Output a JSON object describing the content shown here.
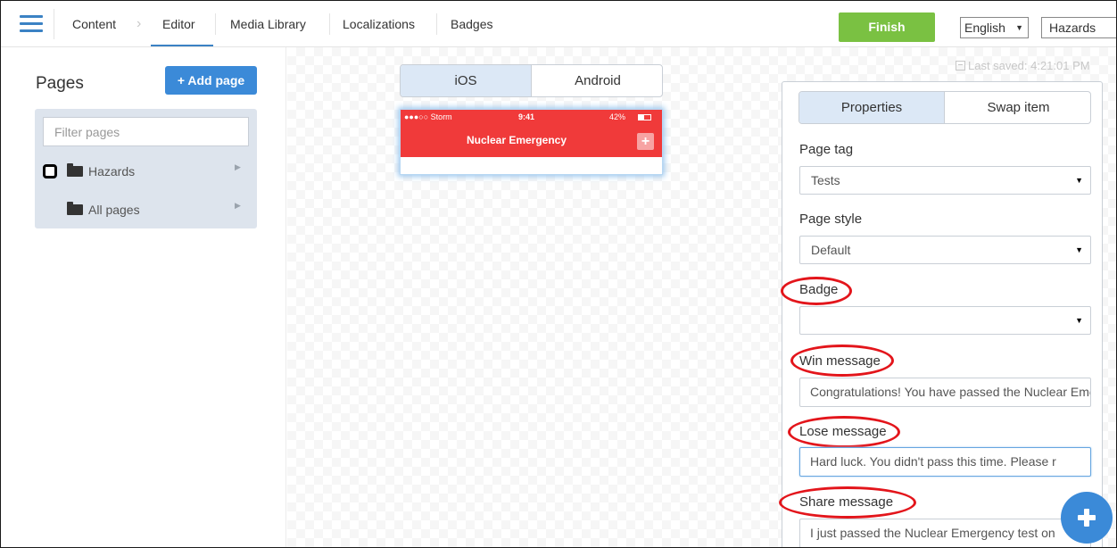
{
  "nav": {
    "items": [
      "Content",
      "Editor",
      "Media Library",
      "Localizations",
      "Badges"
    ],
    "active": "Editor",
    "finish_label": "Finish",
    "language": "English",
    "hazards": "Hazards"
  },
  "sidebar": {
    "title": "Pages",
    "add_page_label": "+ Add page",
    "filter_placeholder": "Filter pages",
    "tree": [
      {
        "label": "Hazards"
      },
      {
        "label": "All pages"
      }
    ]
  },
  "editor": {
    "os_tabs": [
      "iOS",
      "Android"
    ],
    "active_os": "iOS",
    "phone": {
      "carrier": "●●●○○ Storm",
      "time": "9:41",
      "battery": "42%",
      "title": "Nuclear Emergency",
      "add_symbol": "+"
    },
    "last_saved": "Last saved: 4:21:01 PM"
  },
  "properties": {
    "tabs": [
      "Properties",
      "Swap item"
    ],
    "active_tab": "Properties",
    "page_tag_label": "Page tag",
    "page_tag_value": "Tests",
    "page_style_label": "Page style",
    "page_style_value": "Default",
    "badge_label": "Badge",
    "badge_value": "",
    "win_label": "Win message",
    "win_value": "Congratulations! You have passed the Nuclear Emergency",
    "lose_label": "Lose message",
    "lose_value": "Hard luck. You didn't pass this time. Please r",
    "share_label": "Share message",
    "share_value": "I just passed the Nuclear Emergency test on"
  },
  "colors": {
    "accent": "#3b8ad8",
    "finish": "#7ac142",
    "phone_header": "#f03a3a",
    "annotation": "#e3151b"
  }
}
